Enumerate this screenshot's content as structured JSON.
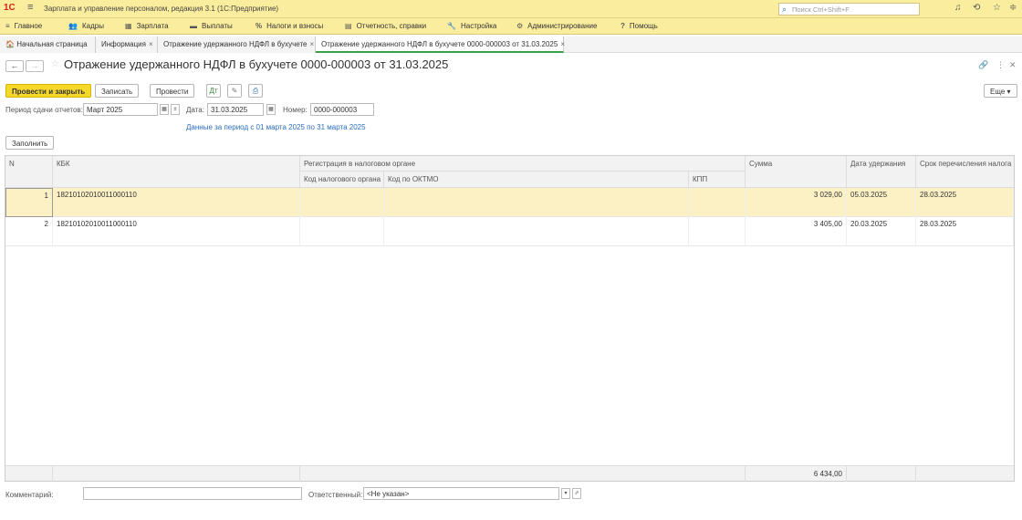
{
  "app": {
    "logo": "1С",
    "title": "Зарплата и управление персоналом, редакция 3.1  (1С:Предприятие)",
    "search_placeholder": "Поиск Ctrl+Shift+F"
  },
  "menu": [
    {
      "icon": "≡",
      "label": "Главное"
    },
    {
      "icon": "👥",
      "label": "Кадры"
    },
    {
      "icon": "▦",
      "label": "Зарплата"
    },
    {
      "icon": "▬",
      "label": "Выплаты"
    },
    {
      "icon": "%",
      "label": "Налоги и взносы"
    },
    {
      "icon": "▤",
      "label": "Отчетность, справки"
    },
    {
      "icon": "🔧",
      "label": "Настройка"
    },
    {
      "icon": "⚙",
      "label": "Администрирование"
    },
    {
      "icon": "?",
      "label": "Помощь"
    }
  ],
  "tabs": [
    {
      "label": "Начальная страница",
      "icon": "🏠"
    },
    {
      "label": "Информация",
      "close": "×"
    },
    {
      "label": "Отражение удержанного НДФЛ в бухучете",
      "close": "×"
    },
    {
      "label": "Отражение удержанного НДФЛ в бухучете 0000-000003 от 31.03.2025",
      "close": "×"
    }
  ],
  "form": {
    "title": "Отражение удержанного НДФЛ в бухучете 0000-000003 от 31.03.2025",
    "buttons": {
      "post_close": "Провести и закрыть",
      "save": "Записать",
      "post": "Провести",
      "more": "Еще ▾",
      "fill": "Заполнить"
    },
    "period_label": "Период сдачи отчетов:",
    "period_value": "Март 2025",
    "date_label": "Дата:",
    "date_value": "31.03.2025",
    "number_label": "Номер:",
    "number_value": "0000-000003",
    "period_hint": "Данные за период с 01 марта 2025 по 31 марта 2025"
  },
  "table": {
    "headers": {
      "n": "N",
      "kbk": "КБК",
      "reg": "Регистрация в налоговом органе",
      "reg_code": "Код налогового органа",
      "oktmo": "Код по ОКТМО",
      "kpp": "КПП",
      "sum": "Сумма",
      "date": "Дата удержания",
      "due": "Срок перечисления налога"
    },
    "rows": [
      {
        "n": "1",
        "kbk": "18210102010011000110",
        "sum": "3 029,00",
        "date": "05.03.2025",
        "due": "28.03.2025"
      },
      {
        "n": "2",
        "kbk": "18210102010011000110",
        "sum": "3 405,00",
        "date": "20.03.2025",
        "due": "28.03.2025"
      }
    ],
    "total": "6 434,00"
  },
  "bottom": {
    "comment_label": "Комментарий:",
    "comment_value": "",
    "resp_label": "Ответственный:",
    "resp_value": "<Не указан>"
  },
  "colors": {
    "header_bg": "#fbed9e",
    "primary_button": "#f6d82b",
    "selected_row": "#fcf1c5",
    "active_tab_accent": "#3aa04a",
    "link": "#2a6dbf"
  }
}
